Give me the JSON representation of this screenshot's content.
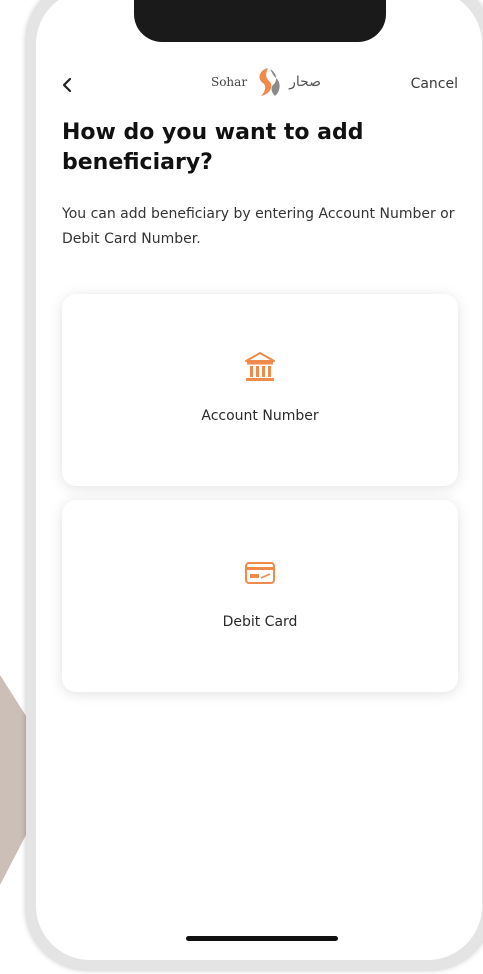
{
  "header": {
    "back_icon": "chevron-left-icon",
    "logo_text_en": "Sohar",
    "logo_text_ar": "صحار",
    "cancel_label": "Cancel"
  },
  "content": {
    "title": "How do you want to add beneficiary?",
    "subtitle": "You can add beneficiary by entering Account Number or Debit Card Number."
  },
  "options": [
    {
      "label": "Account Number",
      "icon": "bank-icon"
    },
    {
      "label": "Debit Card",
      "icon": "credit-card-icon"
    }
  ],
  "colors": {
    "accent": "#f08a4b",
    "text": "#111111",
    "background": "#ffffff"
  }
}
